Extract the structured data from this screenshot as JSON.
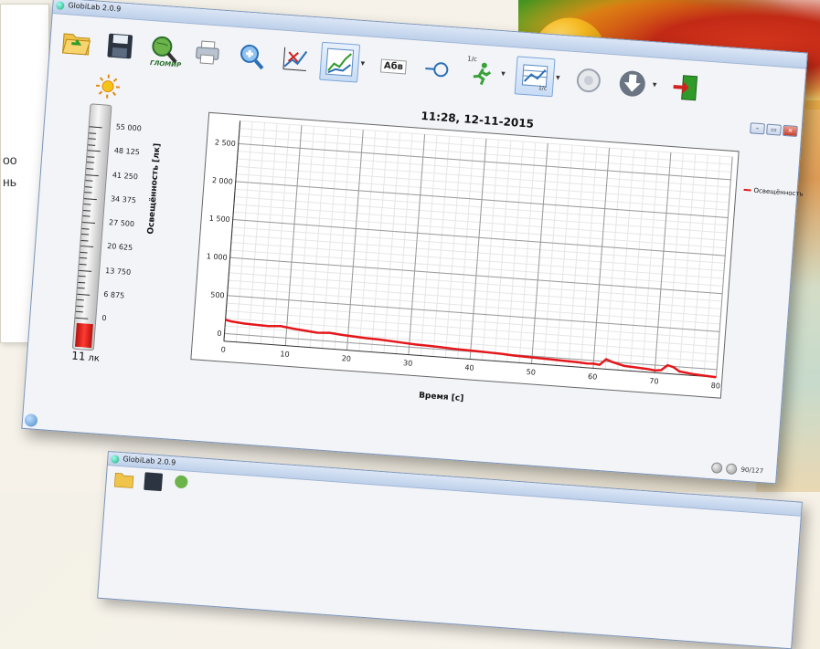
{
  "slide": {
    "text_lines": [
      "оо",
      "нь"
    ]
  },
  "window": {
    "title": "GlobiLab 2.0.9",
    "controls": {
      "minimize": "–",
      "maximize": "▭",
      "close": "✕"
    }
  },
  "toolbar": {
    "items": [
      {
        "id": "open",
        "icon": "folder-open-icon"
      },
      {
        "id": "save",
        "icon": "floppy-disk-icon"
      },
      {
        "id": "glomir",
        "icon": "globe-magnifier-icon",
        "label": "ГЛОМИР"
      },
      {
        "id": "print",
        "icon": "printer-icon"
      },
      {
        "id": "zoom",
        "icon": "zoom-in-icon"
      },
      {
        "id": "markers",
        "icon": "marker-graph-icon"
      },
      {
        "id": "graph",
        "icon": "line-graph-icon",
        "selected": true
      },
      {
        "id": "text",
        "icon": "text-label-icon",
        "label": "Абв"
      },
      {
        "id": "point",
        "icon": "point-marker-icon"
      },
      {
        "id": "rate",
        "icon": "running-man-icon",
        "label": "1/c"
      },
      {
        "id": "table",
        "icon": "table-view-icon",
        "label": "1/c",
        "selected": true
      },
      {
        "id": "record",
        "icon": "record-icon"
      },
      {
        "id": "download",
        "icon": "download-icon"
      },
      {
        "id": "exit",
        "icon": "exit-door-icon"
      }
    ]
  },
  "sensor": {
    "icon": "sun-icon",
    "scale": [
      "55 000",
      "48 125",
      "41 250",
      "34 375",
      "27 500",
      "20 625",
      "13 750",
      "6 875",
      "0"
    ],
    "reading_value": "11",
    "reading_unit": "лк",
    "scale_max": 55000,
    "value": 11
  },
  "status": {
    "counter": "90/127"
  },
  "colors": {
    "series": "#e4171b",
    "accent": "#7aa3d8"
  },
  "chart_data": {
    "type": "line",
    "title": "11:28, 12-11-2015",
    "xlabel": "Время [с]",
    "ylabel": "Освещённость [лк]",
    "xlim": [
      0,
      80
    ],
    "ylim": [
      -100,
      2800
    ],
    "x_ticks": [
      0,
      10,
      20,
      30,
      40,
      50,
      60,
      70,
      80
    ],
    "y_ticks": [
      0,
      500,
      1000,
      1500,
      2000,
      2500
    ],
    "y_tick_labels": [
      "0",
      "500",
      "1 000",
      "1 500",
      "2 000",
      "2 500"
    ],
    "grid": true,
    "legend_position": "right",
    "series": [
      {
        "name": "Освещённость",
        "color": "#e4171b",
        "x": [
          0,
          1,
          3,
          5,
          7,
          9,
          11,
          13,
          15,
          17,
          19,
          21,
          23,
          25,
          27,
          29,
          31,
          33,
          35,
          37,
          39,
          41,
          43,
          45,
          47,
          49,
          51,
          53,
          55,
          57,
          59,
          60,
          61,
          62,
          63,
          65,
          67,
          69,
          70,
          71,
          72,
          73,
          74,
          75,
          76,
          78,
          80
        ],
        "y": [
          180,
          165,
          150,
          145,
          140,
          150,
          130,
          115,
          100,
          110,
          95,
          85,
          75,
          70,
          60,
          50,
          40,
          35,
          30,
          20,
          15,
          10,
          5,
          0,
          -10,
          -15,
          -20,
          -25,
          -30,
          -35,
          -45,
          -40,
          -50,
          30,
          0,
          -40,
          -50,
          -60,
          -70,
          -60,
          10,
          -10,
          -60,
          -70,
          -80,
          -90,
          -100
        ]
      }
    ]
  },
  "second_window": {
    "title": "GlobiLab 2.0.9"
  }
}
